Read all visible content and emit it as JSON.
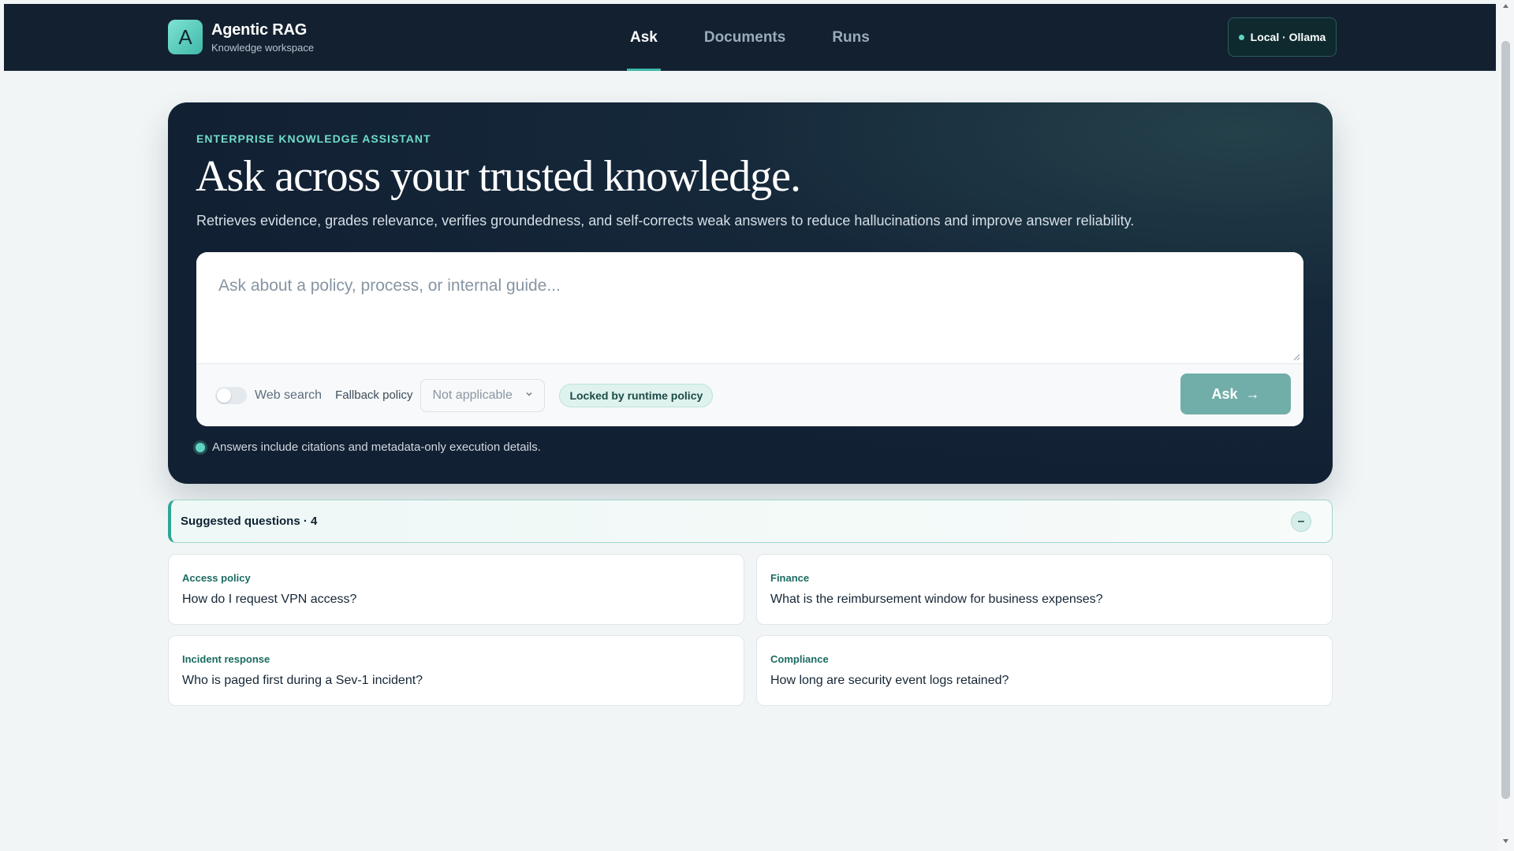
{
  "app": {
    "name": "Agentic RAG",
    "subtitle": "Knowledge workspace",
    "logo_letter": "A",
    "accent_color": "#3fb8a9"
  },
  "nav": {
    "tabs": [
      {
        "label": "Ask",
        "active": true
      },
      {
        "label": "Documents",
        "active": false
      },
      {
        "label": "Runs",
        "active": false
      }
    ]
  },
  "environment": {
    "label": "Local · Ollama",
    "status_color": "#5fd4c2"
  },
  "hero": {
    "eyebrow": "ENTERPRISE KNOWLEDGE ASSISTANT",
    "title": "Ask across your trusted knowledge.",
    "description": "Retrieves evidence, grades relevance, verifies groundedness, and self-corrects weak answers to reduce hallucinations and improve answer reliability.",
    "note": "Answers include citations and metadata-only execution details."
  },
  "composer": {
    "question_value": "",
    "placeholder": "Ask about a policy, process, or internal guide...",
    "web_search_label": "Web search",
    "web_search_enabled": false,
    "fallback_label": "Fallback policy",
    "fallback_selected": "Not applicable",
    "lock_badge": "Locked by runtime policy",
    "ask_label": "Ask",
    "ask_arrow": "→"
  },
  "suggested": {
    "header": "Suggested questions · 4",
    "collapse_symbol": "–",
    "items": [
      {
        "category": "Access policy",
        "question": "How do I request VPN access?"
      },
      {
        "category": "Finance",
        "question": "What is the reimbursement window for business expenses?"
      },
      {
        "category": "Incident response",
        "question": "Who is paged first during a Sev-1 incident?"
      },
      {
        "category": "Compliance",
        "question": "How long are security event logs retained?"
      }
    ]
  }
}
